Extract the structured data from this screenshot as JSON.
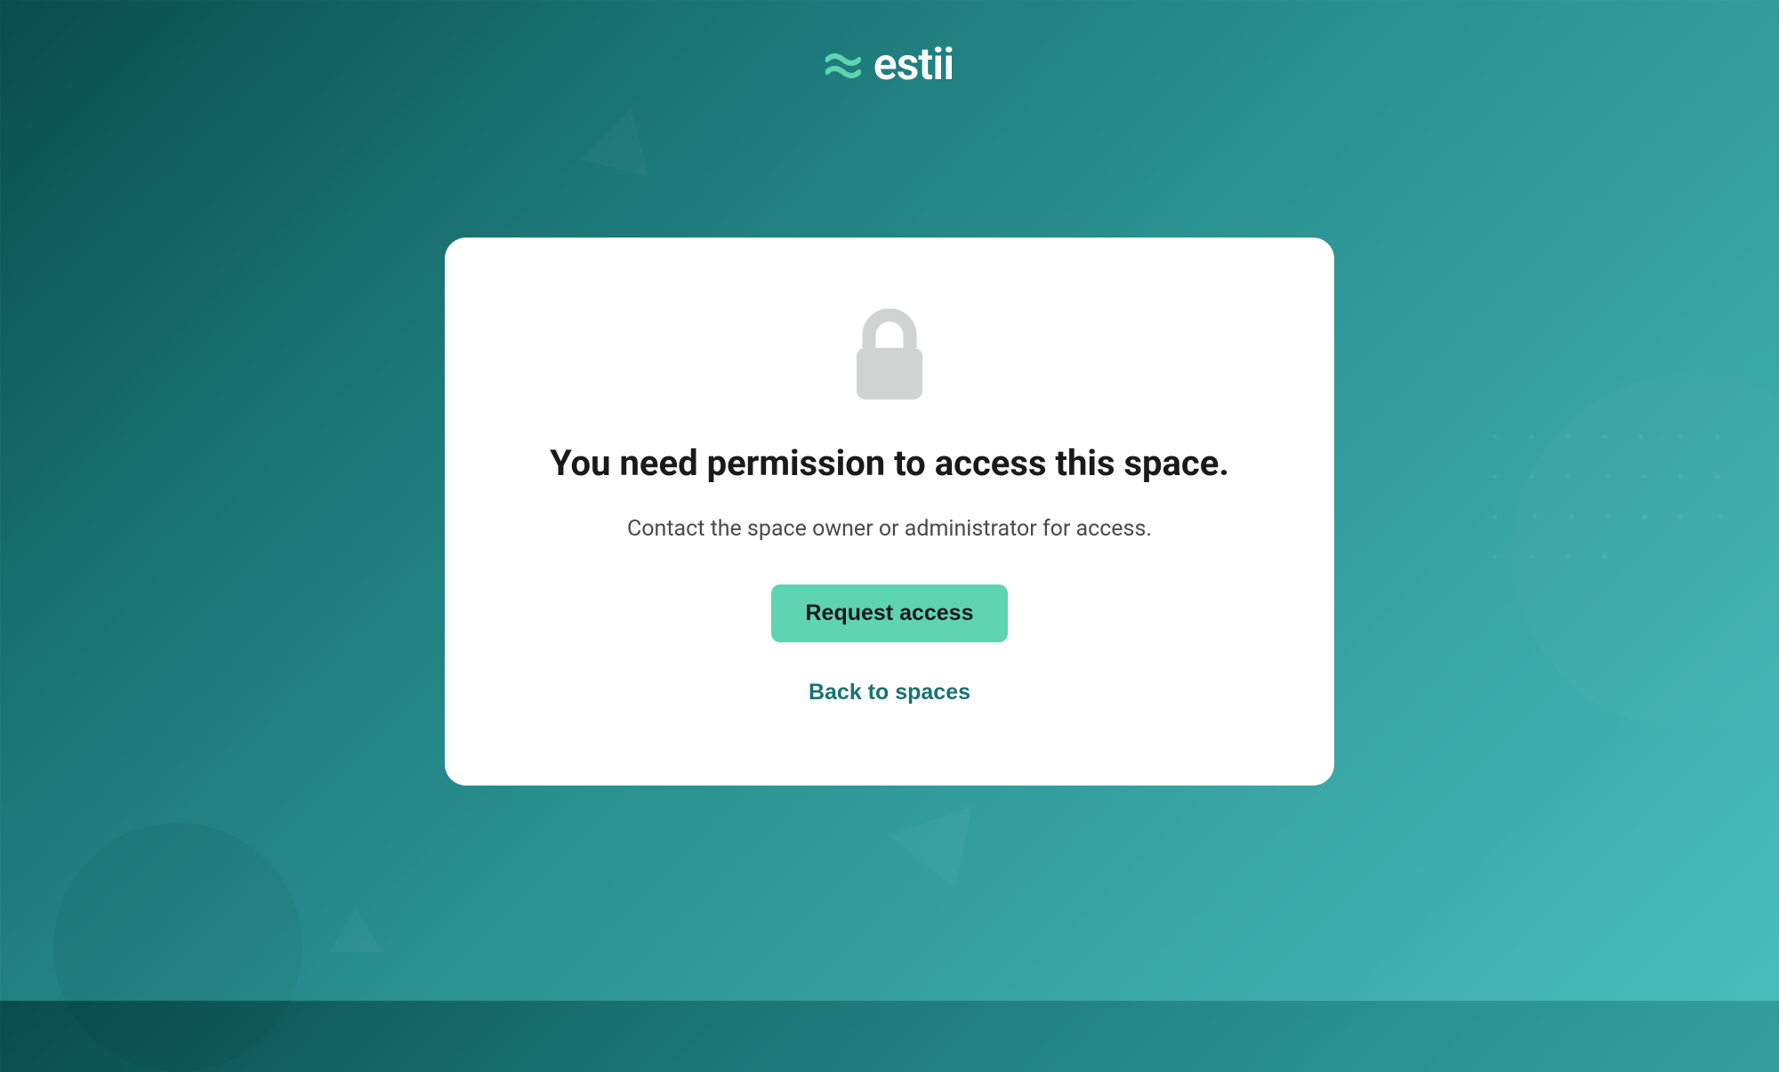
{
  "brand": {
    "name": "estii"
  },
  "card": {
    "heading": "You need permission to access this space.",
    "subtext": "Contact the space owner or administrator for access.",
    "primary_button_label": "Request access",
    "link_label": "Back to spaces"
  }
}
